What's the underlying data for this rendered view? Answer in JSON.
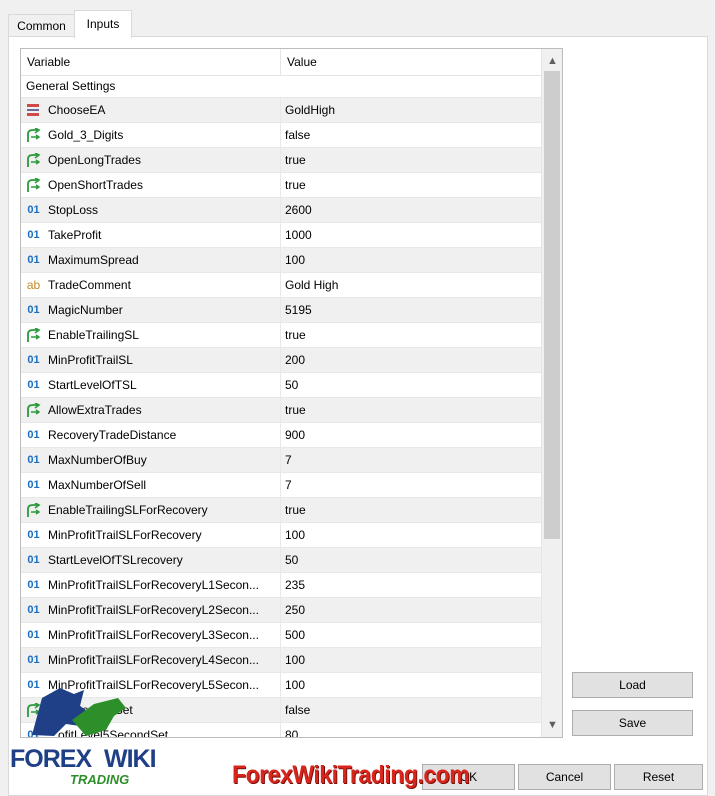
{
  "tabs": [
    {
      "label": "Common"
    },
    {
      "label": "Inputs"
    }
  ],
  "grid": {
    "headers": {
      "variable": "Variable",
      "value": "Value"
    },
    "group_label": "General Settings",
    "rows": [
      {
        "icon": "list-icon",
        "name": "ChooseEA",
        "value": "GoldHigh"
      },
      {
        "icon": "bool-icon",
        "name": "Gold_3_Digits",
        "value": "false"
      },
      {
        "icon": "bool-icon",
        "name": "OpenLongTrades",
        "value": "true"
      },
      {
        "icon": "bool-icon",
        "name": "OpenShortTrades",
        "value": "true"
      },
      {
        "icon": "number-icon",
        "name": "StopLoss",
        "value": "2600"
      },
      {
        "icon": "number-icon",
        "name": "TakeProfit",
        "value": "1000"
      },
      {
        "icon": "number-icon",
        "name": "MaximumSpread",
        "value": "100"
      },
      {
        "icon": "string-icon",
        "name": "TradeComment",
        "value": "Gold High"
      },
      {
        "icon": "number-icon",
        "name": "MagicNumber",
        "value": "5195"
      },
      {
        "icon": "bool-icon",
        "name": "EnableTrailingSL",
        "value": "true"
      },
      {
        "icon": "number-icon",
        "name": "MinProfitTrailSL",
        "value": "200"
      },
      {
        "icon": "number-icon",
        "name": "StartLevelOfTSL",
        "value": "50"
      },
      {
        "icon": "bool-icon",
        "name": "AllowExtraTrades",
        "value": "true"
      },
      {
        "icon": "number-icon",
        "name": "RecoveryTradeDistance",
        "value": "900"
      },
      {
        "icon": "number-icon",
        "name": "MaxNumberOfBuy",
        "value": "7"
      },
      {
        "icon": "number-icon",
        "name": "MaxNumberOfSell",
        "value": "7"
      },
      {
        "icon": "bool-icon",
        "name": "EnableTrailingSLForRecovery",
        "value": "true"
      },
      {
        "icon": "number-icon",
        "name": "MinProfitTrailSLForRecovery",
        "value": "100"
      },
      {
        "icon": "number-icon",
        "name": "StartLevelOfTSLrecovery",
        "value": "50"
      },
      {
        "icon": "number-icon",
        "name": "MinProfitTrailSLForRecoveryL1Secon...",
        "value": "235"
      },
      {
        "icon": "number-icon",
        "name": "MinProfitTrailSLForRecoveryL2Secon...",
        "value": "250"
      },
      {
        "icon": "number-icon",
        "name": "MinProfitTrailSLForRecoveryL3Secon...",
        "value": "500"
      },
      {
        "icon": "number-icon",
        "name": "MinProfitTrailSLForRecoveryL4Secon...",
        "value": "100"
      },
      {
        "icon": "number-icon",
        "name": "MinProfitTrailSLForRecoveryL5Secon...",
        "value": "100"
      },
      {
        "icon": "bool-icon",
        "name": "...el5SecondSet",
        "value": "false"
      },
      {
        "icon": "number-icon",
        "name": "...ofitLevel5SecondSet",
        "value": "80"
      }
    ],
    "icon_glyphs": {
      "number": "01",
      "string": "ab"
    }
  },
  "buttons": {
    "load": "Load",
    "save": "Save",
    "ok": "OK",
    "cancel": "Cancel",
    "reset": "Reset"
  },
  "watermark": "ForexWikiTrading.com",
  "logo": {
    "forex": "FOREX",
    "wiki": "WIKI",
    "trading": "TRADING"
  },
  "colors": {
    "number_icon": "#1a6fc0",
    "bool_icon": "#2a9a3a",
    "string_icon": "#c08a2a",
    "watermark": "#d9261c",
    "logo_blue": "#1f3f86",
    "logo_green": "#2d8f2a"
  }
}
